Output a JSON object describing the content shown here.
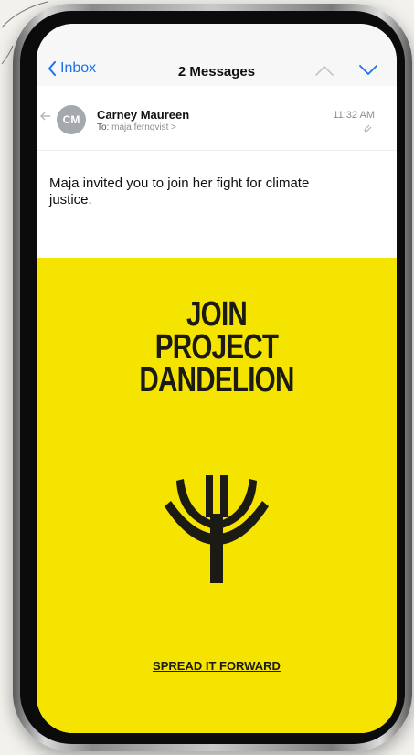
{
  "nav": {
    "back_label": "Inbox",
    "title": "2 Messages"
  },
  "email": {
    "avatar_initials": "CM",
    "sender": "Carney Maureen",
    "to_label": "To:",
    "to_value": "maja fernqvist >",
    "time": "11:32 AM",
    "body": "Maja invited you to join her fight for climate justice."
  },
  "promo": {
    "headline_lines": [
      "JOIN",
      "PROJECT",
      "DANDELION"
    ],
    "cta": "SPREAD IT FORWARD"
  },
  "colors": {
    "accent_blue": "#1a73e8",
    "promo_yellow": "#f5e400",
    "ink": "#1b1a14"
  },
  "icons": [
    "chevron-left-icon",
    "chevron-up-icon",
    "chevron-down-icon",
    "reply-icon",
    "attachment-icon",
    "dandelion-logo-icon"
  ]
}
